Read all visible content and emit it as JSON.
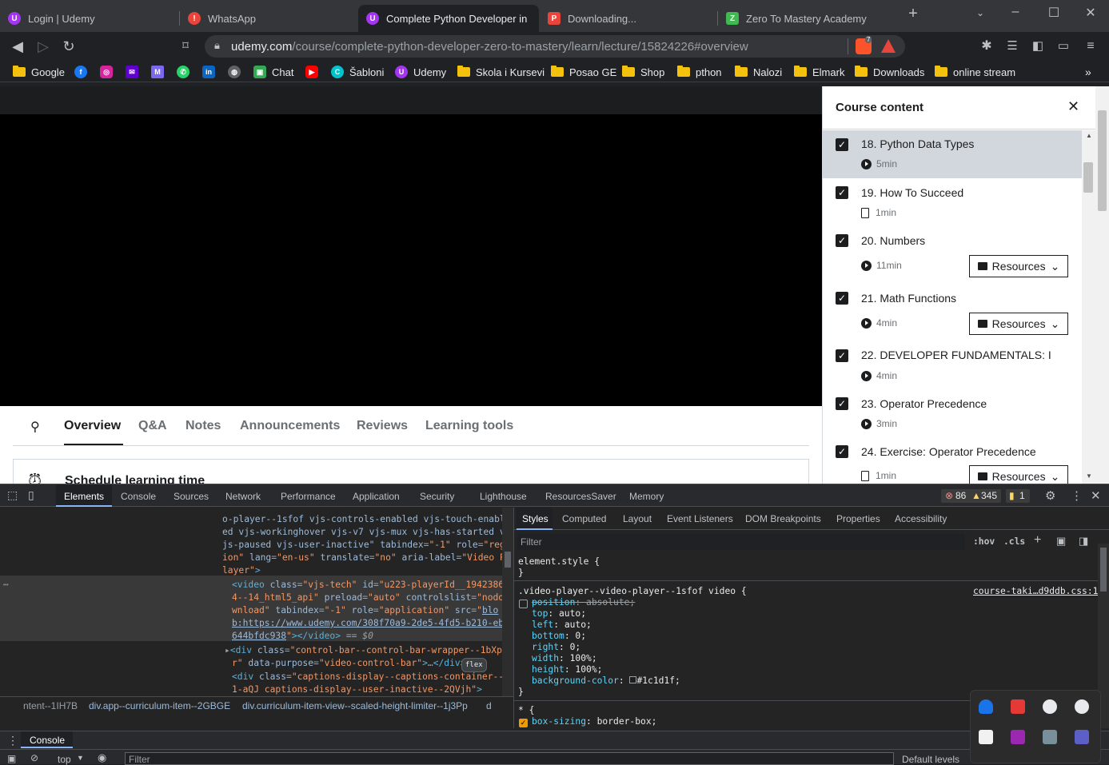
{
  "tabs": [
    {
      "title": "Login | Udemy",
      "color": "#a435f0",
      "glyph": "U"
    },
    {
      "title": "WhatsApp",
      "color": "#e8453c",
      "glyph": "!"
    },
    {
      "title": "Complete Python Developer in",
      "color": "#a435f0",
      "glyph": "U"
    },
    {
      "title": "Downloading...",
      "color": "#e8453c",
      "glyph": "P"
    },
    {
      "title": "Zero To Mastery Academy",
      "color": "#3fb950",
      "glyph": "Z"
    }
  ],
  "address": {
    "domain": "udemy.com",
    "path": "/course/complete-python-developer-zero-to-mastery/learn/lecture/15824226#overview",
    "brave_count": "7"
  },
  "bookmarks": [
    {
      "label": "Google",
      "type": "folder"
    },
    {
      "label": "",
      "type": "icon",
      "color": "#1877f2",
      "glyph": "f"
    },
    {
      "label": "",
      "type": "icon",
      "color": "#d6249f",
      "glyph": "◎"
    },
    {
      "label": "",
      "type": "icon",
      "color": "#6001d2",
      "glyph": "✉"
    },
    {
      "label": "",
      "type": "icon",
      "color": "#7b68ee",
      "glyph": "M"
    },
    {
      "label": "",
      "type": "icon",
      "color": "#25d366",
      "glyph": "✆"
    },
    {
      "label": "",
      "type": "icon",
      "color": "#0a66c2",
      "glyph": "in"
    },
    {
      "label": "",
      "type": "icon",
      "color": "#5f6368",
      "glyph": "◍"
    },
    {
      "label": "Chat",
      "type": "icon",
      "color": "#34a853",
      "glyph": "▣"
    },
    {
      "label": "",
      "type": "icon",
      "color": "#ff0000",
      "glyph": "▶"
    },
    {
      "label": "Šabloni",
      "type": "icon",
      "color": "#00c4cc",
      "glyph": "C"
    },
    {
      "label": "Udemy",
      "type": "icon",
      "color": "#a435f0",
      "glyph": "U"
    },
    {
      "label": "Skola i Kursevi",
      "type": "folder"
    },
    {
      "label": "Posao GE",
      "type": "folder"
    },
    {
      "label": "Shop",
      "type": "folder"
    },
    {
      "label": "pthon",
      "type": "folder"
    },
    {
      "label": "Nalozi",
      "type": "folder"
    },
    {
      "label": "Elmark",
      "type": "folder"
    },
    {
      "label": "Downloads",
      "type": "folder"
    },
    {
      "label": "online stream",
      "type": "folder"
    }
  ],
  "course_nav": {
    "tabs": [
      "Overview",
      "Q&A",
      "Notes",
      "Announcements",
      "Reviews",
      "Learning tools"
    ],
    "active": "Overview"
  },
  "schedule_title": "Schedule learning time",
  "sidebar": {
    "title": "Course content",
    "items": [
      {
        "title": "18. Python Data Types",
        "duration": "5min",
        "kind": "video",
        "resources": false,
        "current": true
      },
      {
        "title": "19. How To Succeed",
        "duration": "1min",
        "kind": "article",
        "resources": false,
        "current": false
      },
      {
        "title": "20. Numbers",
        "duration": "11min",
        "kind": "video",
        "resources": true,
        "current": false
      },
      {
        "title": "21. Math Functions",
        "duration": "4min",
        "kind": "video",
        "resources": true,
        "current": false
      },
      {
        "title": "22. DEVELOPER FUNDAMENTALS: I",
        "duration": "4min",
        "kind": "video",
        "resources": false,
        "current": false
      },
      {
        "title": "23. Operator Precedence",
        "duration": "3min",
        "kind": "video",
        "resources": false,
        "current": false
      },
      {
        "title": "24. Exercise: Operator Precedence",
        "duration": "1min",
        "kind": "article",
        "resources": true,
        "current": false
      }
    ],
    "resources_label": "Resources"
  },
  "devtools": {
    "tabs": [
      "Elements",
      "Console",
      "Sources",
      "Network",
      "Performance",
      "Application",
      "Security",
      "Lighthouse",
      "ResourcesSaver",
      "Memory"
    ],
    "active": "Elements",
    "errors": "86",
    "warnings": "345",
    "issues": "1",
    "style_tabs": [
      "Styles",
      "Computed",
      "Layout",
      "Event Listeners",
      "DOM Breakpoints",
      "Properties",
      "Accessibility"
    ],
    "filter_placeholder": "Filter",
    "hov": ":hov",
    "cls": ".cls",
    "rule_selector": ".video-player--video-player--1sfof video {",
    "rule_source": "course-taki…d9ddb.css:1",
    "element_style": "element.style {",
    "crumbs": [
      "ntent--1IH7B",
      "div.app--curriculum-item--2GBGE",
      "div.curriculum-item-view--scaled-height-limiter--1j3Pp",
      "d"
    ],
    "drawer_tab": "Console",
    "console_context": "top",
    "console_filter": "Filter",
    "default_levels": "Default levels",
    "flex_badge": "flex"
  }
}
